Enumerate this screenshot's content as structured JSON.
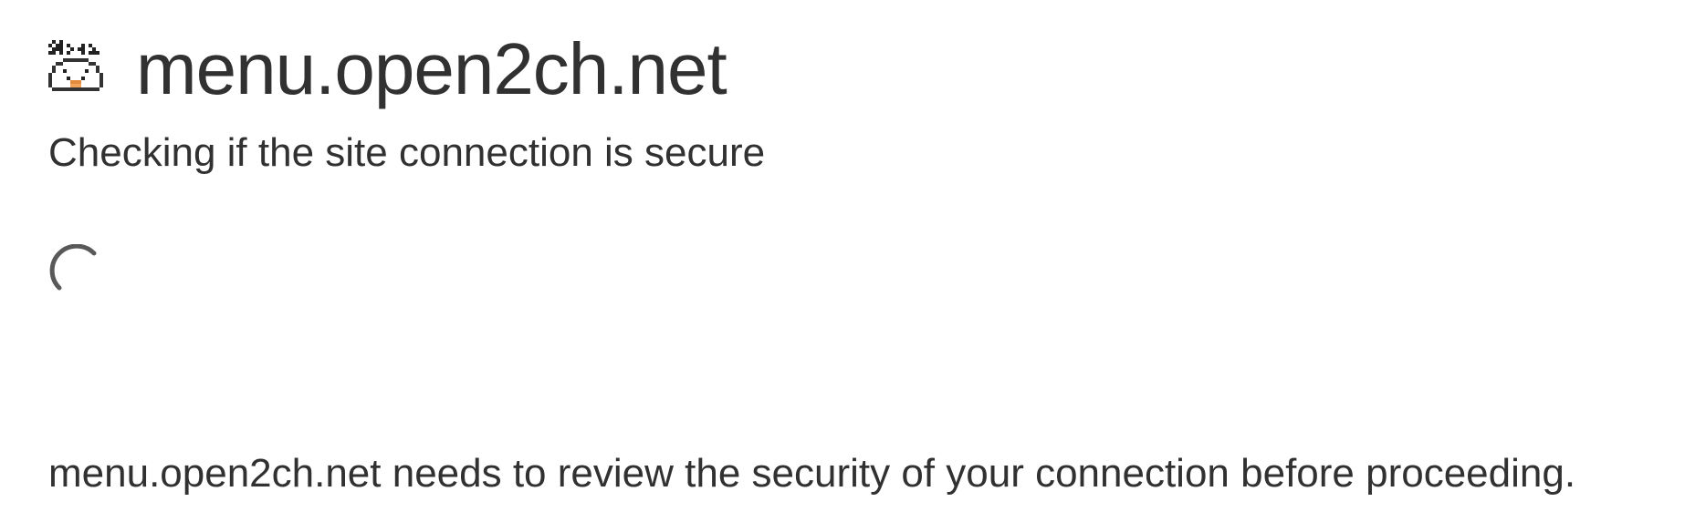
{
  "header": {
    "favicon": "site-favicon-icon",
    "site_name": "menu.open2ch.net"
  },
  "status": {
    "heading": "Checking if the site connection is secure",
    "spinner": "loading-spinner-icon"
  },
  "message": {
    "text": "menu.open2ch.net needs to review the security of your connection before proceeding."
  },
  "colors": {
    "text": "#313131",
    "spinner": "#595959",
    "background": "#ffffff"
  }
}
